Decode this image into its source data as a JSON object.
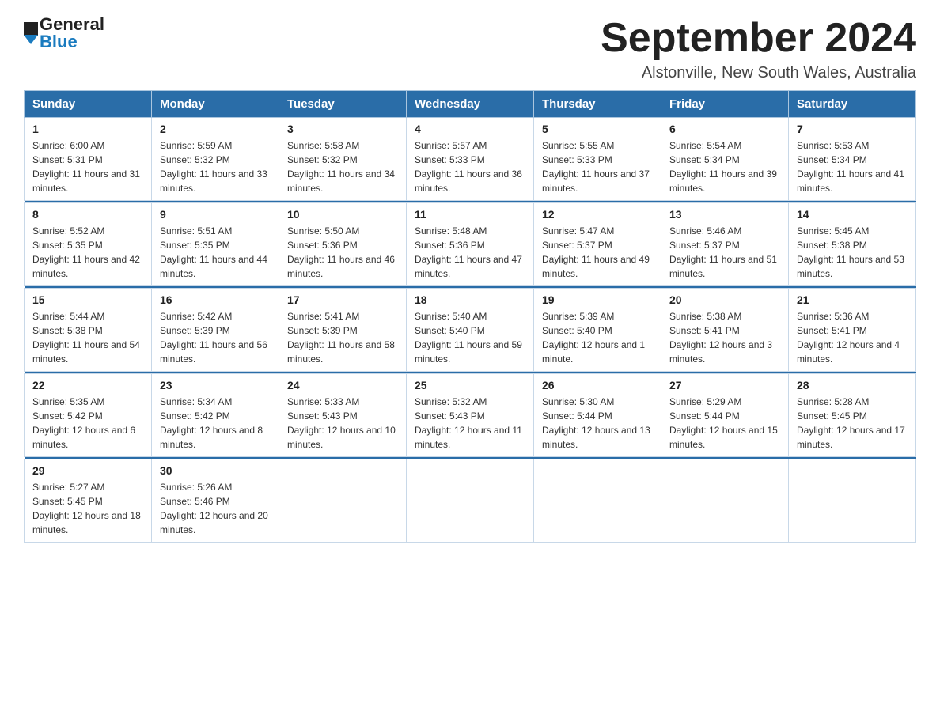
{
  "logo": {
    "line1": "General",
    "line2": "Blue"
  },
  "header": {
    "month": "September 2024",
    "location": "Alstonville, New South Wales, Australia"
  },
  "days_of_week": [
    "Sunday",
    "Monday",
    "Tuesday",
    "Wednesday",
    "Thursday",
    "Friday",
    "Saturday"
  ],
  "weeks": [
    [
      {
        "day": "1",
        "sunrise": "6:00 AM",
        "sunset": "5:31 PM",
        "daylight": "11 hours and 31 minutes."
      },
      {
        "day": "2",
        "sunrise": "5:59 AM",
        "sunset": "5:32 PM",
        "daylight": "11 hours and 33 minutes."
      },
      {
        "day": "3",
        "sunrise": "5:58 AM",
        "sunset": "5:32 PM",
        "daylight": "11 hours and 34 minutes."
      },
      {
        "day": "4",
        "sunrise": "5:57 AM",
        "sunset": "5:33 PM",
        "daylight": "11 hours and 36 minutes."
      },
      {
        "day": "5",
        "sunrise": "5:55 AM",
        "sunset": "5:33 PM",
        "daylight": "11 hours and 37 minutes."
      },
      {
        "day": "6",
        "sunrise": "5:54 AM",
        "sunset": "5:34 PM",
        "daylight": "11 hours and 39 minutes."
      },
      {
        "day": "7",
        "sunrise": "5:53 AM",
        "sunset": "5:34 PM",
        "daylight": "11 hours and 41 minutes."
      }
    ],
    [
      {
        "day": "8",
        "sunrise": "5:52 AM",
        "sunset": "5:35 PM",
        "daylight": "11 hours and 42 minutes."
      },
      {
        "day": "9",
        "sunrise": "5:51 AM",
        "sunset": "5:35 PM",
        "daylight": "11 hours and 44 minutes."
      },
      {
        "day": "10",
        "sunrise": "5:50 AM",
        "sunset": "5:36 PM",
        "daylight": "11 hours and 46 minutes."
      },
      {
        "day": "11",
        "sunrise": "5:48 AM",
        "sunset": "5:36 PM",
        "daylight": "11 hours and 47 minutes."
      },
      {
        "day": "12",
        "sunrise": "5:47 AM",
        "sunset": "5:37 PM",
        "daylight": "11 hours and 49 minutes."
      },
      {
        "day": "13",
        "sunrise": "5:46 AM",
        "sunset": "5:37 PM",
        "daylight": "11 hours and 51 minutes."
      },
      {
        "day": "14",
        "sunrise": "5:45 AM",
        "sunset": "5:38 PM",
        "daylight": "11 hours and 53 minutes."
      }
    ],
    [
      {
        "day": "15",
        "sunrise": "5:44 AM",
        "sunset": "5:38 PM",
        "daylight": "11 hours and 54 minutes."
      },
      {
        "day": "16",
        "sunrise": "5:42 AM",
        "sunset": "5:39 PM",
        "daylight": "11 hours and 56 minutes."
      },
      {
        "day": "17",
        "sunrise": "5:41 AM",
        "sunset": "5:39 PM",
        "daylight": "11 hours and 58 minutes."
      },
      {
        "day": "18",
        "sunrise": "5:40 AM",
        "sunset": "5:40 PM",
        "daylight": "11 hours and 59 minutes."
      },
      {
        "day": "19",
        "sunrise": "5:39 AM",
        "sunset": "5:40 PM",
        "daylight": "12 hours and 1 minute."
      },
      {
        "day": "20",
        "sunrise": "5:38 AM",
        "sunset": "5:41 PM",
        "daylight": "12 hours and 3 minutes."
      },
      {
        "day": "21",
        "sunrise": "5:36 AM",
        "sunset": "5:41 PM",
        "daylight": "12 hours and 4 minutes."
      }
    ],
    [
      {
        "day": "22",
        "sunrise": "5:35 AM",
        "sunset": "5:42 PM",
        "daylight": "12 hours and 6 minutes."
      },
      {
        "day": "23",
        "sunrise": "5:34 AM",
        "sunset": "5:42 PM",
        "daylight": "12 hours and 8 minutes."
      },
      {
        "day": "24",
        "sunrise": "5:33 AM",
        "sunset": "5:43 PM",
        "daylight": "12 hours and 10 minutes."
      },
      {
        "day": "25",
        "sunrise": "5:32 AM",
        "sunset": "5:43 PM",
        "daylight": "12 hours and 11 minutes."
      },
      {
        "day": "26",
        "sunrise": "5:30 AM",
        "sunset": "5:44 PM",
        "daylight": "12 hours and 13 minutes."
      },
      {
        "day": "27",
        "sunrise": "5:29 AM",
        "sunset": "5:44 PM",
        "daylight": "12 hours and 15 minutes."
      },
      {
        "day": "28",
        "sunrise": "5:28 AM",
        "sunset": "5:45 PM",
        "daylight": "12 hours and 17 minutes."
      }
    ],
    [
      {
        "day": "29",
        "sunrise": "5:27 AM",
        "sunset": "5:45 PM",
        "daylight": "12 hours and 18 minutes."
      },
      {
        "day": "30",
        "sunrise": "5:26 AM",
        "sunset": "5:46 PM",
        "daylight": "12 hours and 20 minutes."
      },
      null,
      null,
      null,
      null,
      null
    ]
  ],
  "labels": {
    "sunrise": "Sunrise:",
    "sunset": "Sunset:",
    "daylight": "Daylight:"
  }
}
